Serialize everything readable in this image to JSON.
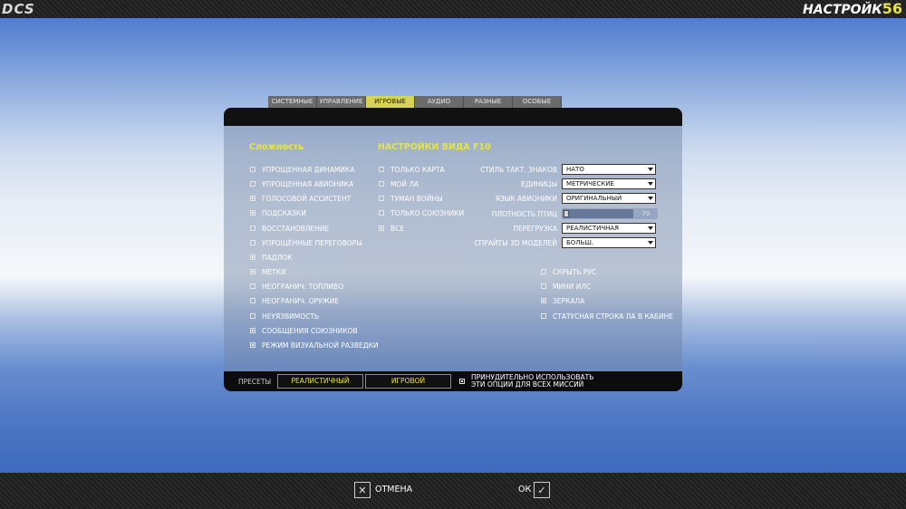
{
  "header": {
    "logo": "DCS",
    "title": "НАСТРОЙК",
    "title_number": "56"
  },
  "tabs": [
    {
      "label": "СИСТЕМНЫЕ",
      "active": false
    },
    {
      "label": "УПРАВЛЕНИЕ",
      "active": false
    },
    {
      "label": "ИГРОВЫЕ",
      "active": true
    },
    {
      "label": "АУДИО",
      "active": false
    },
    {
      "label": "РАЗНЫЕ",
      "active": false
    },
    {
      "label": "ОСОБЫЕ",
      "active": false
    }
  ],
  "difficulty": {
    "title": "Сложность",
    "options": [
      {
        "label": "УПРОЩЕННАЯ ДИНАМИКА",
        "checked": false
      },
      {
        "label": "УПРОЩЕННАЯ АВИОНИКА",
        "checked": false
      },
      {
        "label": "ГОЛОСОВОЙ АССИСТЕНТ",
        "checked": true
      },
      {
        "label": "ПОДСКАЗКИ",
        "checked": true
      },
      {
        "label": "ВОССТАНОВЛЕНИЕ",
        "checked": false
      },
      {
        "label": "УПРОЩЁННЫЕ ПЕРЕГОВОРЫ",
        "checked": false
      },
      {
        "label": "ПАДЛОК",
        "checked": true
      },
      {
        "label": "МЕТКИ",
        "checked": true
      },
      {
        "label": "НЕОГРАНИЧ. ТОПЛИВО",
        "checked": false
      },
      {
        "label": "НЕОГРАНИЧ. ОРУЖИЕ",
        "checked": false
      },
      {
        "label": "НЕУЯЗВИМОСТЬ",
        "checked": false
      },
      {
        "label": "СООБЩЕНИЯ СОЮЗНИКОВ",
        "checked": true
      },
      {
        "label": "РЕЖИМ ВИЗУАЛЬНОЙ РАЗВЕДКИ",
        "checked": true
      }
    ]
  },
  "f10": {
    "title": "НАСТРОЙКИ ВИДА F10",
    "options": [
      {
        "label": "ТОЛЬКО КАРТА",
        "checked": false
      },
      {
        "label": "МОЙ ЛА",
        "checked": false
      },
      {
        "label": "ТУМАН ВОЙНЫ",
        "checked": false
      },
      {
        "label": "ТОЛЬКО СОЮЗНИКИ",
        "checked": false
      },
      {
        "label": "ВСЕ",
        "checked": true
      }
    ]
  },
  "settings": [
    {
      "label": "СТИЛЬ ТАКТ. ЗНАКОВ",
      "value": "НАТО"
    },
    {
      "label": "ЕДИНИЦЫ",
      "value": "МЕТРИЧЕСКИЕ"
    },
    {
      "label": "ЯЗЫК АВИОНИКИ",
      "value": "ОРИГИНАЛЬНЫЙ"
    },
    {
      "label": "ПЛОТНОСТЬ ПТИЦ",
      "value": "0"
    },
    {
      "label": "ПЕРЕГРУЗКА",
      "value": "РЕАЛИСТИЧНАЯ"
    },
    {
      "label": "СПРАЙТЫ 3D МОДЕЛЕЙ",
      "value": "БОЛЬШ."
    }
  ],
  "bird_slider": {
    "value": 0,
    "max_label": "70"
  },
  "cockpit_options": [
    {
      "label": "СКРЫТЬ РУС",
      "checked": false
    },
    {
      "label": "МИНИ ИЛС",
      "checked": false
    },
    {
      "label": "ЗЕРКАЛА",
      "checked": true
    },
    {
      "label": "СТАТУСНАЯ СТРОКА ЛА В КАБИНЕ",
      "checked": false
    }
  ],
  "footer": {
    "presets_label": "ПРЕСЕТЫ",
    "preset_realistic": "РЕАЛИСТИЧНЫЙ",
    "preset_game": "ИГРОВОЙ",
    "force_line1": "ПРИНУДИТЕЛЬНО ИСПОЛЬЗОВАТЬ",
    "force_line2": "ЭТИ ОПЦИИ ДЛЯ ВСЕХ МИССИЙ",
    "force_checked": true
  },
  "bottom": {
    "cancel_label": "ОТМЕНА",
    "ok_label": "ОК"
  },
  "colors": {
    "accent": "#e8e34a",
    "panel_dark": "#111111"
  }
}
